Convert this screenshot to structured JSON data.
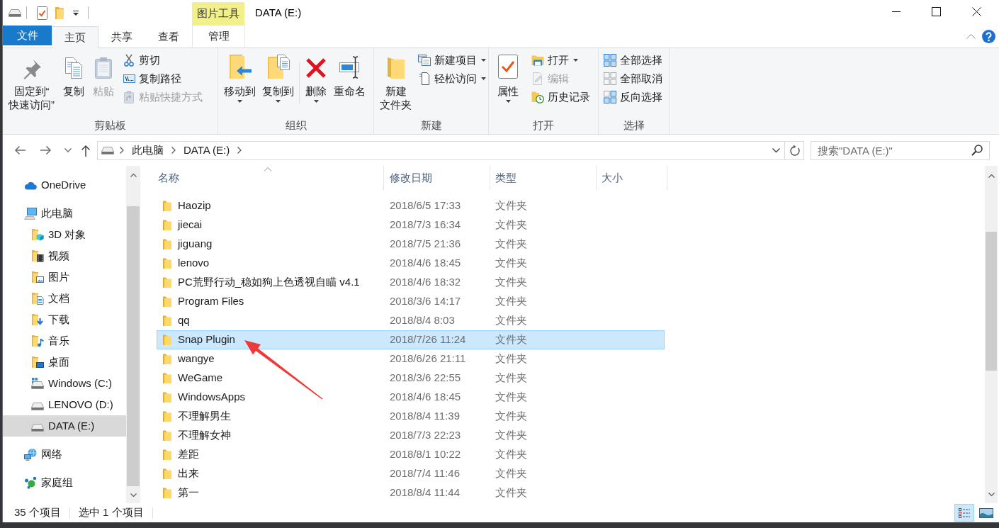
{
  "window": {
    "title": "DATA (E:)",
    "context_tab_group": "图片工具"
  },
  "ribbon_tabs": [
    {
      "label": "文件",
      "kind": "file",
      "selected": false
    },
    {
      "label": "主页",
      "kind": "tab",
      "selected": true
    },
    {
      "label": "共享",
      "kind": "tab",
      "selected": false
    },
    {
      "label": "查看",
      "kind": "tab",
      "selected": false
    },
    {
      "label": "管理",
      "kind": "context",
      "selected": false
    }
  ],
  "ribbon_groups": [
    {
      "label": "剪贴板",
      "items": [
        {
          "kind": "large",
          "lines": [
            "固定到“",
            "快速访问”"
          ],
          "disabled": false,
          "dropdown": false
        },
        {
          "kind": "large",
          "lines": [
            "复制"
          ],
          "disabled": false,
          "dropdown": false
        },
        {
          "kind": "large",
          "lines": [
            "粘贴"
          ],
          "disabled": true,
          "dropdown": false
        },
        {
          "kind": "small",
          "label": "剪切",
          "disabled": false,
          "dropdown": false
        },
        {
          "kind": "small",
          "label": "复制路径",
          "disabled": false,
          "dropdown": false
        },
        {
          "kind": "small",
          "label": "粘贴快捷方式",
          "disabled": true,
          "dropdown": false
        }
      ]
    },
    {
      "label": "组织",
      "items": [
        {
          "kind": "large",
          "lines": [
            "移动到"
          ],
          "disabled": false,
          "dropdown": true
        },
        {
          "kind": "large",
          "lines": [
            "复制到"
          ],
          "disabled": false,
          "dropdown": true
        },
        {
          "kind": "separator"
        },
        {
          "kind": "large",
          "lines": [
            "删除"
          ],
          "disabled": false,
          "dropdown": true
        },
        {
          "kind": "large",
          "lines": [
            "重命名"
          ],
          "disabled": false,
          "dropdown": false
        }
      ]
    },
    {
      "label": "新建",
      "items": [
        {
          "kind": "large",
          "lines": [
            "新建",
            "文件夹"
          ],
          "disabled": false,
          "dropdown": false
        },
        {
          "kind": "small",
          "label": "新建项目",
          "disabled": false,
          "dropdown": true
        },
        {
          "kind": "small",
          "label": "轻松访问",
          "disabled": false,
          "dropdown": true
        }
      ]
    },
    {
      "label": "打开",
      "items": [
        {
          "kind": "large",
          "lines": [
            "属性"
          ],
          "disabled": false,
          "dropdown": true
        },
        {
          "kind": "small",
          "label": "打开",
          "disabled": false,
          "dropdown": true
        },
        {
          "kind": "small",
          "label": "编辑",
          "disabled": true,
          "dropdown": false
        },
        {
          "kind": "small",
          "label": "历史记录",
          "disabled": false,
          "dropdown": false
        }
      ]
    },
    {
      "label": "选择",
      "items": [
        {
          "kind": "small",
          "label": "全部选择",
          "disabled": false,
          "dropdown": false
        },
        {
          "kind": "small",
          "label": "全部取消",
          "disabled": false,
          "dropdown": false
        },
        {
          "kind": "small",
          "label": "反向选择",
          "disabled": false,
          "dropdown": false
        }
      ]
    }
  ],
  "address_bar": {
    "crumbs": [
      "此电脑",
      "DATA (E:)"
    ]
  },
  "search": {
    "placeholder": "搜索\"DATA (E:)\""
  },
  "nav": {
    "items": [
      {
        "label": "OneDrive",
        "kind": "cloud",
        "selected": false
      },
      {
        "label": "此电脑",
        "kind": "computer",
        "selected": false,
        "children": [
          {
            "label": "3D 对象",
            "kind": "objects-folder",
            "selected": false
          },
          {
            "label": "视频",
            "kind": "videos-folder",
            "selected": false
          },
          {
            "label": "图片",
            "kind": "pictures-folder",
            "selected": false
          },
          {
            "label": "文档",
            "kind": "documents-folder",
            "selected": false
          },
          {
            "label": "下载",
            "kind": "downloads-folder",
            "selected": false
          },
          {
            "label": "音乐",
            "kind": "music-folder",
            "selected": false
          },
          {
            "label": "桌面",
            "kind": "desktop-folder",
            "selected": false
          },
          {
            "label": "Windows (C:)",
            "kind": "system-drive",
            "selected": false
          },
          {
            "label": "LENOVO (D:)",
            "kind": "drive",
            "selected": false
          },
          {
            "label": "DATA (E:)",
            "kind": "drive",
            "selected": true
          }
        ]
      },
      {
        "label": "网络",
        "kind": "network",
        "selected": false
      },
      {
        "label": "家庭组",
        "kind": "homegroup",
        "selected": false
      }
    ]
  },
  "file_list": {
    "columns": [
      {
        "label": "名称",
        "sorted": true
      },
      {
        "label": "修改日期",
        "sorted": false
      },
      {
        "label": "类型",
        "sorted": false
      },
      {
        "label": "大小",
        "sorted": false
      }
    ],
    "rows": [
      {
        "name": "Haozip",
        "modified": "2018/6/5 17:33",
        "type": "文件夹",
        "selected": false
      },
      {
        "name": "jiecai",
        "modified": "2018/7/3 16:34",
        "type": "文件夹",
        "selected": false
      },
      {
        "name": "jiguang",
        "modified": "2018/7/5 21:36",
        "type": "文件夹",
        "selected": false
      },
      {
        "name": "lenovo",
        "modified": "2018/4/6 18:45",
        "type": "文件夹",
        "selected": false
      },
      {
        "name": "PC荒野行动_稳如狗上色透视自瞄 v4.1",
        "modified": "2018/4/6 18:32",
        "type": "文件夹",
        "selected": false
      },
      {
        "name": "Program Files",
        "modified": "2018/3/6 14:17",
        "type": "文件夹",
        "selected": false
      },
      {
        "name": "qq",
        "modified": "2018/8/4 8:03",
        "type": "文件夹",
        "selected": false
      },
      {
        "name": "Snap Plugin",
        "modified": "2018/7/26 11:24",
        "type": "文件夹",
        "selected": true
      },
      {
        "name": "wangye",
        "modified": "2018/6/26 21:11",
        "type": "文件夹",
        "selected": false
      },
      {
        "name": "WeGame",
        "modified": "2018/3/6 22:55",
        "type": "文件夹",
        "selected": false
      },
      {
        "name": "WindowsApps",
        "modified": "2018/4/6 18:45",
        "type": "文件夹",
        "selected": false
      },
      {
        "name": "不理解男生",
        "modified": "2018/8/4 11:39",
        "type": "文件夹",
        "selected": false
      },
      {
        "name": "不理解女神",
        "modified": "2018/7/3 22:23",
        "type": "文件夹",
        "selected": false
      },
      {
        "name": "差距",
        "modified": "2018/8/1 10:22",
        "type": "文件夹",
        "selected": false
      },
      {
        "name": "出来",
        "modified": "2018/7/4 11:46",
        "type": "文件夹",
        "selected": false
      },
      {
        "name": "第一",
        "modified": "2018/8/4 11:44",
        "type": "文件夹",
        "selected": false
      }
    ]
  },
  "status_bar": {
    "item_count": "35 个项目",
    "selection": "选中 1 个项目",
    "views": [
      {
        "kind": "details",
        "selected": true
      },
      {
        "kind": "large-icons",
        "selected": false
      }
    ]
  }
}
